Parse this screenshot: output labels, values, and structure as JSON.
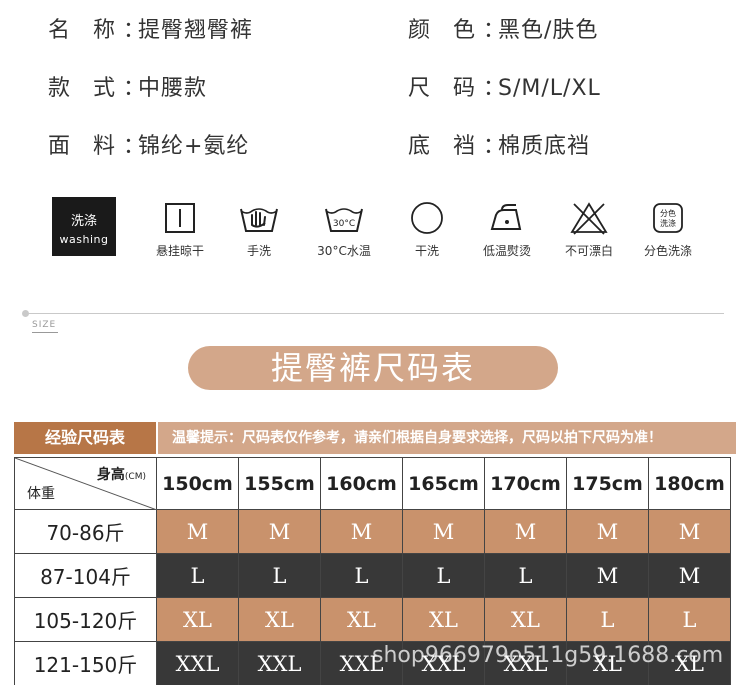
{
  "specs": {
    "name": {
      "key": "名 称：",
      "value": "提臀翘臀裤"
    },
    "color": {
      "key": "颜 色：",
      "value": "黑色/肤色"
    },
    "style": {
      "key": "款 式：",
      "value": "中腰款"
    },
    "size": {
      "key": "尺 码：",
      "value": "S/M/L/XL"
    },
    "fabric": {
      "key": "面 料：",
      "value": "锦纶+氨纶"
    },
    "crotch": {
      "key": "底 裆：",
      "value": "棉质底裆"
    }
  },
  "care": {
    "badge_cn": "洗涤",
    "badge_en": "washing",
    "items": [
      {
        "icon": "hang-dry-icon",
        "label": "悬挂晾干"
      },
      {
        "icon": "hand-wash-icon",
        "label": "手洗"
      },
      {
        "icon": "wash-30-icon",
        "label": "30°C水温",
        "temp": "30°C"
      },
      {
        "icon": "dry-clean-icon",
        "label": "干洗"
      },
      {
        "icon": "low-iron-icon",
        "label": "低温熨烫"
      },
      {
        "icon": "no-bleach-icon",
        "label": "不可漂白"
      },
      {
        "icon": "separate-wash-icon",
        "label": "分色洗涤",
        "icon_text_1": "分色",
        "icon_text_2": "洗涤"
      }
    ]
  },
  "section_label": "SIZE",
  "banner_title": "提臀裤尺码表",
  "table": {
    "header_left": "经验尺码表",
    "header_tip": "温馨提示：尺码表仅作参考，请亲们根据自身要求选择，尺码以拍下尺码为准！",
    "height_label": "身高",
    "height_unit": "(CM)",
    "weight_label": "体重",
    "heights": [
      "150cm",
      "155cm",
      "160cm",
      "165cm",
      "170cm",
      "175cm",
      "180cm"
    ],
    "rows": [
      {
        "weight": "70-86斤",
        "sizes": [
          "M",
          "M",
          "M",
          "M",
          "M",
          "M",
          "M"
        ]
      },
      {
        "weight": "87-104斤",
        "sizes": [
          "L",
          "L",
          "L",
          "L",
          "L",
          "M",
          "M"
        ]
      },
      {
        "weight": "105-120斤",
        "sizes": [
          "XL",
          "XL",
          "XL",
          "XL",
          "XL",
          "L",
          "L"
        ]
      },
      {
        "weight": "121-150斤",
        "sizes": [
          "XXL",
          "XXL",
          "XXL",
          "XXL",
          "XXL",
          "XL",
          "XL"
        ]
      }
    ]
  },
  "watermark": "shop966979o511g59.1688.com",
  "colors": {
    "tan": "#c9926c",
    "dark": "#383838",
    "banner": "#d3a78a",
    "header": "#b77647"
  }
}
